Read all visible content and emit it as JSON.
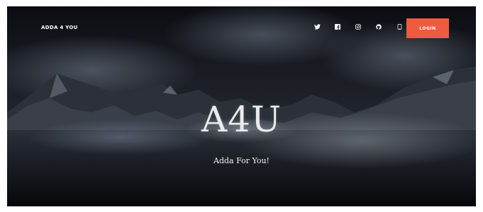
{
  "header": {
    "brand": "ADDA 4 YOU",
    "social": [
      {
        "name": "twitter-icon"
      },
      {
        "name": "facebook-icon"
      },
      {
        "name": "instagram-icon"
      },
      {
        "name": "github-icon"
      },
      {
        "name": "mobile-icon"
      }
    ],
    "login_label": "LOGIN"
  },
  "hero": {
    "title": "A4U",
    "subtitle": "Adda For You!"
  },
  "colors": {
    "accent": "#f05a3f",
    "background": "#14171d",
    "text": "#ffffff"
  }
}
